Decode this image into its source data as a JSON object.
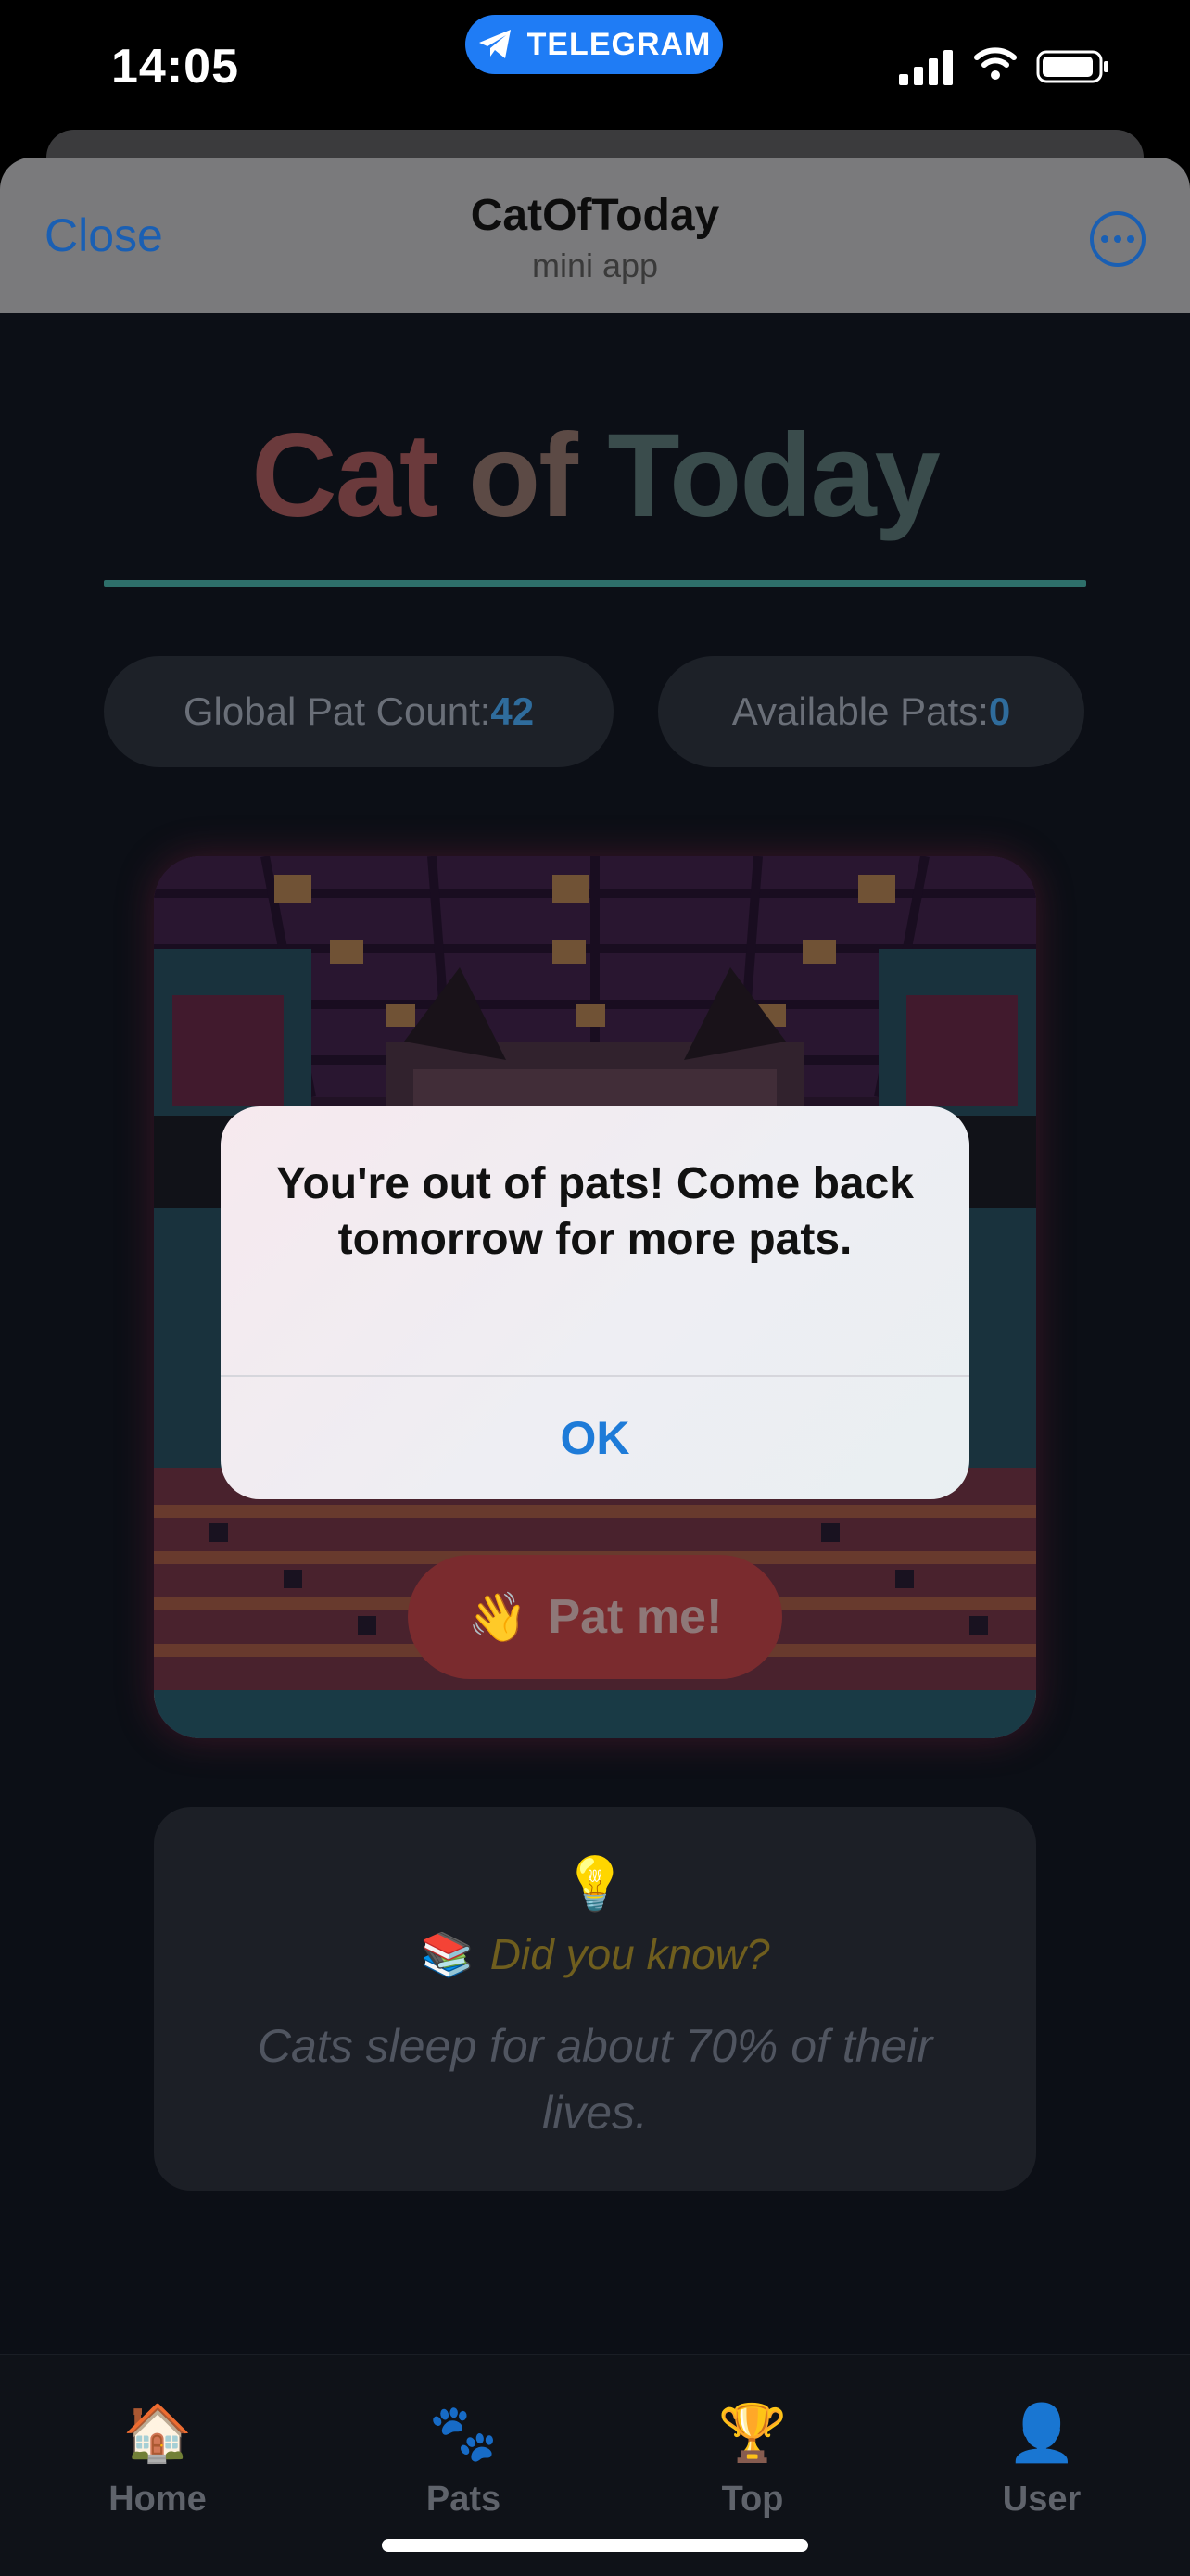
{
  "status_bar": {
    "time": "14:05",
    "telegram_label": "TELEGRAM"
  },
  "app_bar": {
    "close_label": "Close",
    "title": "CatOfToday",
    "subtitle": "mini app",
    "more_icon": "ellipsis-circle-icon"
  },
  "page": {
    "title_part1": "Cat",
    "title_part2": "of",
    "title_part3": "Today",
    "global_pat_label": "Global Pat Count:",
    "global_pat_value": "42",
    "available_pats_label": "Available Pats:",
    "available_pats_value": "0",
    "pat_button_label": "Pat me!",
    "pat_button_icon": "👋"
  },
  "tip": {
    "bulb_icon": "💡",
    "books_icon": "📚",
    "heading": "Did you know?",
    "text": "Cats sleep for about 70% of their lives."
  },
  "nav": {
    "items": [
      {
        "label": "Home",
        "icon": "🏠"
      },
      {
        "label": "Pats",
        "icon": "🐾"
      },
      {
        "label": "Top",
        "icon": "🏆"
      },
      {
        "label": "User",
        "icon": "👤"
      }
    ]
  },
  "alert": {
    "message": "You're out of pats! Come back tomorrow for more pats.",
    "ok_label": "OK"
  },
  "colors": {
    "accent_blue": "#1e7bd8",
    "telegram_blue": "#1f7cf5",
    "pat_button": "#c0393b",
    "title_rule": "#3fa39a"
  }
}
